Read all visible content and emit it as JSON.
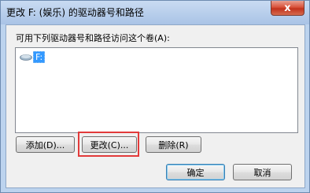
{
  "window": {
    "title": "更改 F: (娱乐) 的驱动器号和路径",
    "close_symbol": "x"
  },
  "dialog": {
    "list_label": "可用下列驱动器号和路径访问这个卷(A):",
    "list_items": [
      {
        "label": "F:",
        "icon": "drive-icon"
      }
    ],
    "buttons": {
      "add": "添加(D)...",
      "change": "更改(C)...",
      "delete": "删除(R)",
      "ok": "确定",
      "cancel": "取消"
    }
  },
  "colors": {
    "selection": "#3399ff",
    "highlight_box": "#e23a3a",
    "title_gradient_top": "#c9dbf2",
    "close_button": "#d9533b"
  }
}
